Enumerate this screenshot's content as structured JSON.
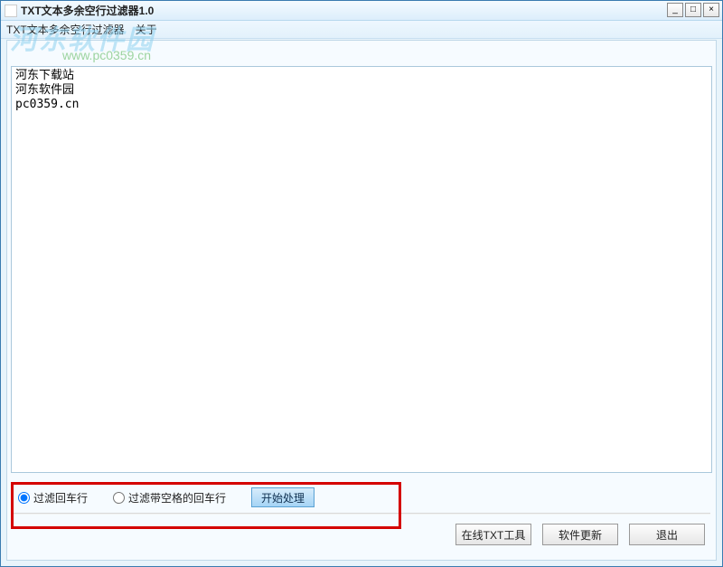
{
  "window": {
    "title": "TXT文本多余空行过滤器1.0"
  },
  "menu": {
    "item1": "TXT文本多余空行过滤器",
    "item2": "关于"
  },
  "watermark": {
    "text": "河东软件园",
    "url": "www.pc0359.cn"
  },
  "textarea": {
    "content": "河东下载站\n河东软件园\npc0359.cn"
  },
  "options": {
    "radio1_label": "过滤回车行",
    "radio2_label": "过滤带空格的回车行",
    "start_label": "开始处理"
  },
  "buttons": {
    "online_tool": "在线TXT工具",
    "update": "软件更新",
    "exit": "退出"
  },
  "winctl": {
    "min": "_",
    "max": "□",
    "close": "×"
  }
}
